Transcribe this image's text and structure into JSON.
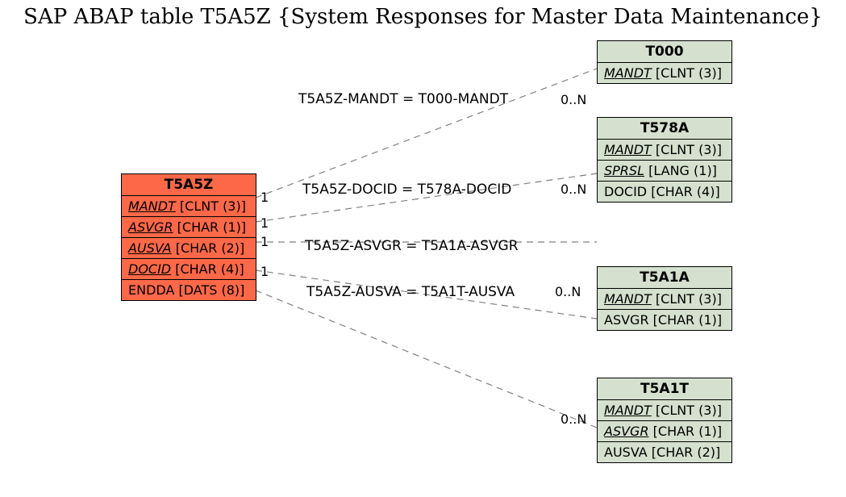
{
  "title": "SAP ABAP table T5A5Z {System Responses for Master Data Maintenance}",
  "entities": {
    "main": {
      "name": "T5A5Z",
      "fields": [
        {
          "key": true,
          "name": "MANDT",
          "type": "[CLNT (3)]"
        },
        {
          "key": true,
          "name": "ASVGR",
          "type": "[CHAR (1)]"
        },
        {
          "key": true,
          "name": "AUSVA",
          "type": "[CHAR (2)]"
        },
        {
          "key": true,
          "name": "DOCID",
          "type": "[CHAR (4)]"
        },
        {
          "key": false,
          "name": "ENDDA",
          "type": "[DATS (8)]"
        }
      ]
    },
    "t000": {
      "name": "T000",
      "fields": [
        {
          "key": true,
          "name": "MANDT",
          "type": "[CLNT (3)]"
        }
      ]
    },
    "t578a": {
      "name": "T578A",
      "fields": [
        {
          "key": true,
          "name": "MANDT",
          "type": "[CLNT (3)]"
        },
        {
          "key": true,
          "name": "SPRSL",
          "type": "[LANG (1)]"
        },
        {
          "key": false,
          "name": "DOCID",
          "type": "[CHAR (4)]"
        }
      ]
    },
    "t5a1a": {
      "name": "T5A1A",
      "fields": [
        {
          "key": true,
          "name": "MANDT",
          "type": "[CLNT (3)]"
        },
        {
          "key": false,
          "name": "ASVGR",
          "type": "[CHAR (1)]"
        }
      ]
    },
    "t5a1t": {
      "name": "T5A1T",
      "fields": [
        {
          "key": true,
          "name": "MANDT",
          "type": "[CLNT (3)]"
        },
        {
          "key": true,
          "name": "ASVGR",
          "type": "[CHAR (1)]"
        },
        {
          "key": false,
          "name": "AUSVA",
          "type": "[CHAR (2)]"
        }
      ]
    }
  },
  "edges": {
    "e1": {
      "label": "T5A5Z-MANDT = T000-MANDT",
      "left_card": "1",
      "right_card": "0..N"
    },
    "e2": {
      "label": "T5A5Z-DOCID = T578A-DOCID",
      "left_card": "1",
      "right_card": "0..N"
    },
    "e3": {
      "label": "T5A5Z-ASVGR = T5A1A-ASVGR",
      "left_card": "1",
      "right_card": ""
    },
    "e4": {
      "label": "T5A5Z-AUSVA = T5A1T-AUSVA",
      "left_card": "1",
      "right_card": "0..N"
    },
    "e5": {
      "label": "",
      "left_card": "",
      "right_card": "0..N"
    }
  }
}
